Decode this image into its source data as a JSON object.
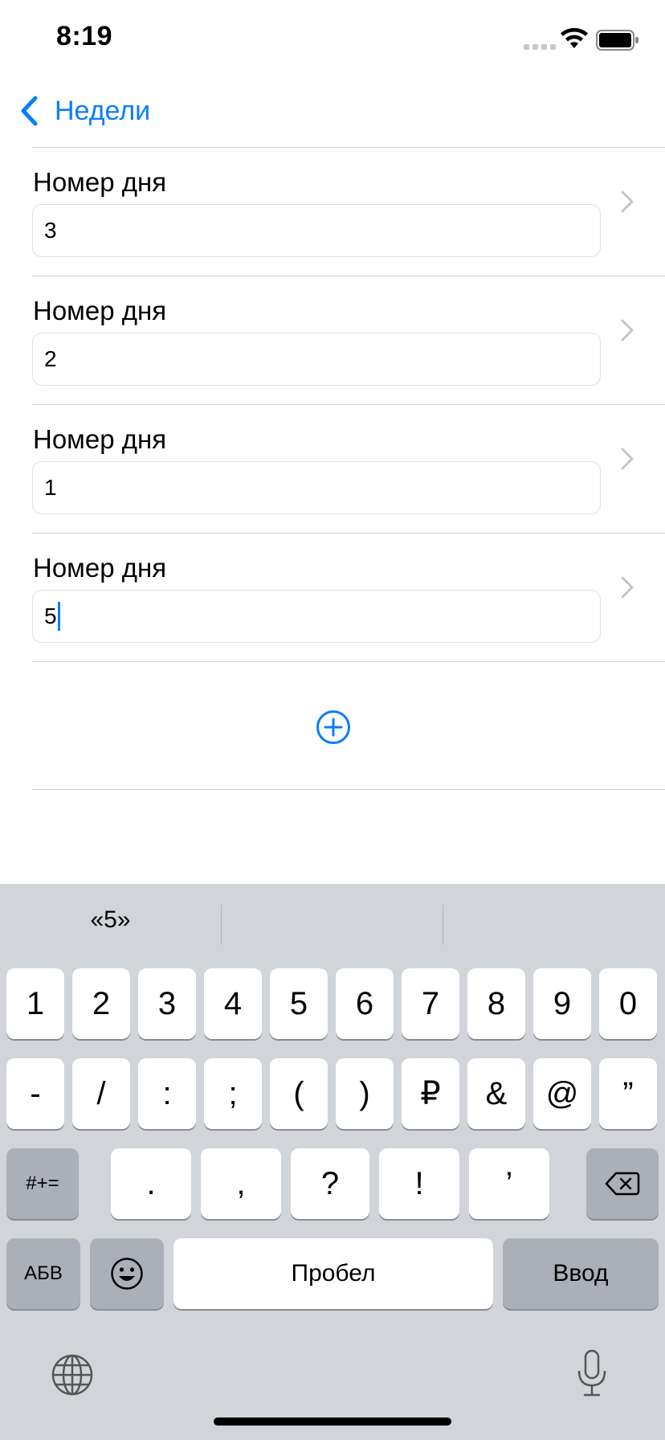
{
  "status_bar": {
    "time": "8:19"
  },
  "nav": {
    "back_label": "Недели"
  },
  "rows": [
    {
      "label": "Номер дня",
      "value": "3"
    },
    {
      "label": "Номер дня",
      "value": "2"
    },
    {
      "label": "Номер дня",
      "value": "1"
    },
    {
      "label": "Номер дня",
      "value": "5"
    }
  ],
  "keyboard": {
    "suggestions": [
      "«5»",
      "",
      ""
    ],
    "row1": [
      "1",
      "2",
      "3",
      "4",
      "5",
      "6",
      "7",
      "8",
      "9",
      "0"
    ],
    "row2": [
      "-",
      "/",
      ":",
      ";",
      "(",
      ")",
      "₽",
      "&",
      "@",
      "”"
    ],
    "row3": {
      "symbols": "#+=",
      "keys": [
        ".",
        ",",
        "?",
        "!",
        "’"
      ]
    },
    "row4": {
      "abc": "АБВ",
      "space": "Пробел",
      "return": "Ввод"
    }
  },
  "colors": {
    "accent": "#0a7cff",
    "keyboard_bg": "#d1d4d9",
    "key_dark": "#abafb7"
  }
}
